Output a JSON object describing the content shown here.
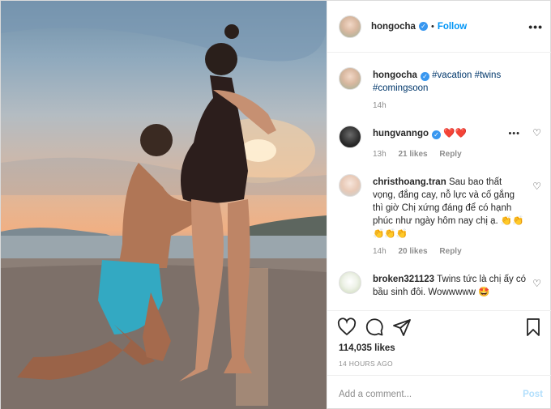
{
  "header": {
    "username": "hongocha",
    "separator": "•",
    "follow_label": "Follow",
    "more_label": "•••"
  },
  "caption": {
    "username": "hongocha",
    "hashtags": [
      "#vacation",
      "#twins",
      "#comingsoon"
    ],
    "time": "14h"
  },
  "comments": [
    {
      "username": "hungvanngo",
      "verified": true,
      "text": "❤️❤️",
      "time": "13h",
      "likes": "21 likes",
      "reply": "Reply",
      "has_options": true
    },
    {
      "username": "christhoang.tran",
      "verified": false,
      "text": "Sau bao thất vọng, đắng cay, nỗ lực và cố gắng thì giờ Chị xứng đáng để có hạnh phúc như ngày hôm nay chị ạ. 👏👏👏👏👏",
      "time": "14h",
      "likes": "20 likes",
      "reply": "Reply",
      "has_options": false
    },
    {
      "username": "broken321123",
      "verified": false,
      "text": "Twins tức là chị ấy có bầu sinh đôi. Wowwwww 🤩",
      "time": "",
      "likes": "",
      "reply": "",
      "has_options": false
    }
  ],
  "actions": {
    "likes_count": "114,035 likes",
    "timestamp": "14 HOURS AGO"
  },
  "add_comment": {
    "placeholder": "Add a comment...",
    "post_label": "Post"
  },
  "icons": {
    "verified": "verified-badge-icon",
    "like": "heart-icon",
    "comment": "comment-bubble-icon",
    "share": "paper-plane-icon",
    "save": "bookmark-icon",
    "more": "ellipsis-icon"
  },
  "colors": {
    "link_blue": "#0095f6",
    "hashtag": "#00376b",
    "muted": "#8e8e8e",
    "post_disabled": "#b2dffc",
    "heart_red": "#ed1c24"
  }
}
